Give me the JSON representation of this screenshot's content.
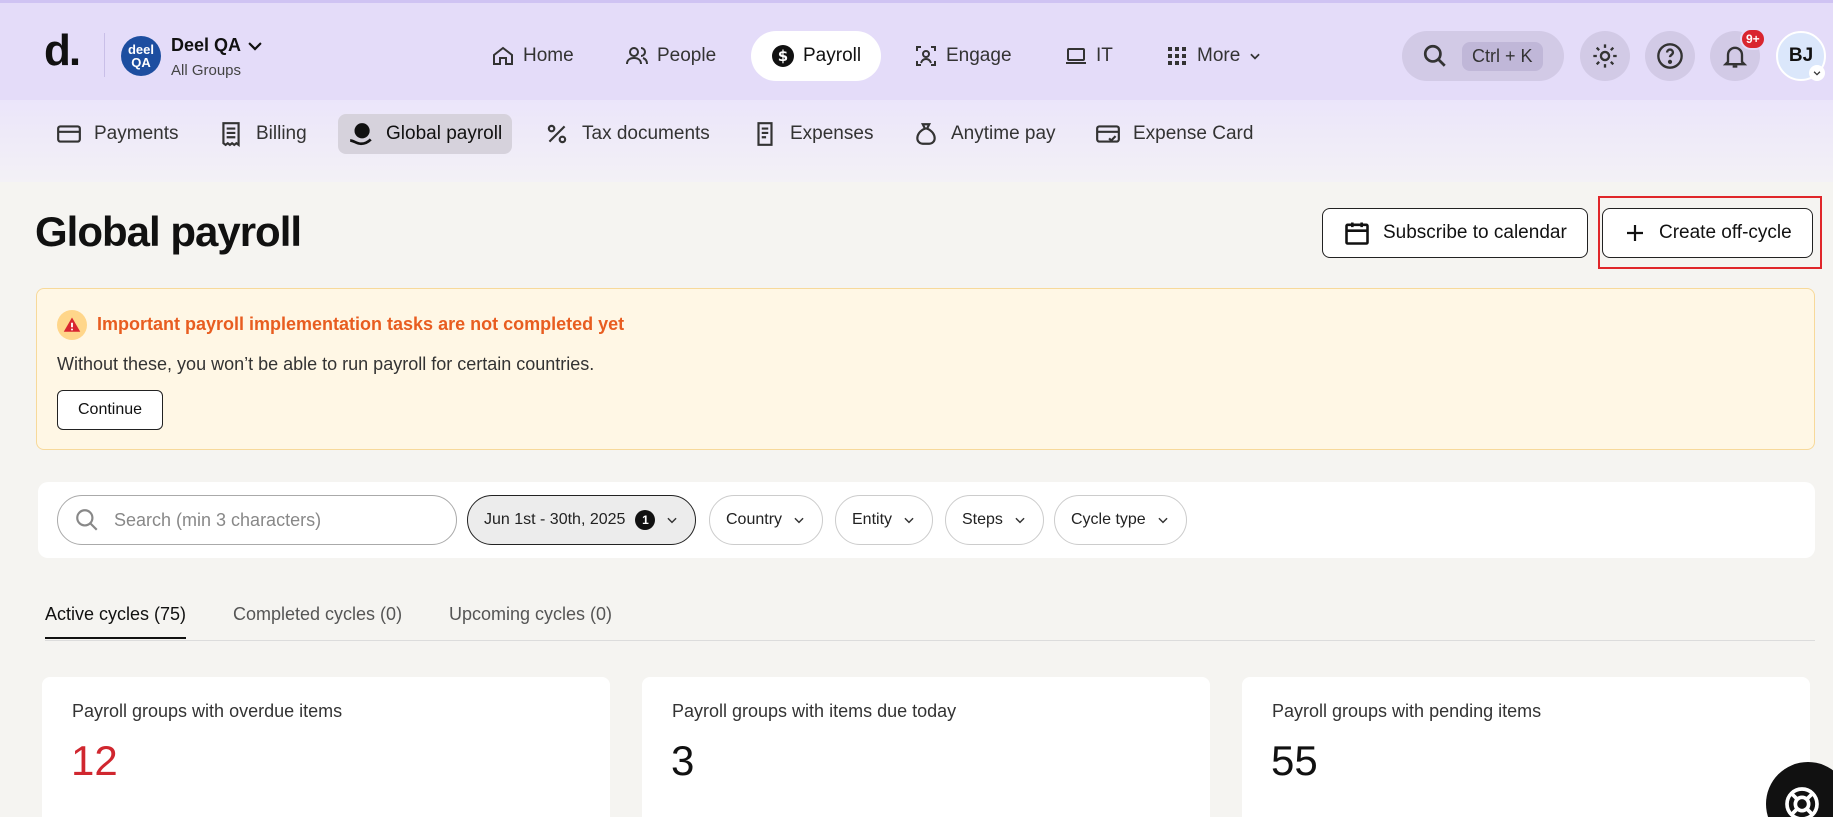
{
  "topbar": {
    "logo": "d.",
    "org": {
      "avatar_text": "deel QA",
      "name": "Deel QA",
      "sub": "All Groups"
    },
    "nav": [
      {
        "label": "Home",
        "icon": "home-icon"
      },
      {
        "label": "People",
        "icon": "people-icon"
      },
      {
        "label": "Payroll",
        "icon": "dollar-circle-icon",
        "active": true
      },
      {
        "label": "Engage",
        "icon": "engage-icon"
      },
      {
        "label": "IT",
        "icon": "laptop-icon"
      },
      {
        "label": "More",
        "icon": "grid-icon"
      }
    ],
    "search_shortcut": "Ctrl + K",
    "notification_badge": "9+",
    "user_initials": "BJ"
  },
  "subnav": [
    {
      "label": "Payments",
      "icon": "card-icon"
    },
    {
      "label": "Billing",
      "icon": "receipt-icon"
    },
    {
      "label": "Global payroll",
      "icon": "globe-hand-icon",
      "active": true
    },
    {
      "label": "Tax documents",
      "icon": "percent-icon"
    },
    {
      "label": "Expenses",
      "icon": "expense-receipt-icon"
    },
    {
      "label": "Anytime pay",
      "icon": "money-bag-icon"
    },
    {
      "label": "Expense Card",
      "icon": "card-check-icon"
    }
  ],
  "header": {
    "title": "Global payroll",
    "subscribe_label": "Subscribe to calendar",
    "create_label": "Create off-cycle"
  },
  "warning": {
    "title": "Important payroll implementation tasks are not completed yet",
    "text": "Without these, you won’t be able to run payroll for certain countries.",
    "button": "Continue"
  },
  "filters": {
    "search_placeholder": "Search (min 3 characters)",
    "date_range": "Jun 1st - 30th, 2025",
    "date_count": "1",
    "chips": [
      "Country",
      "Entity",
      "Steps",
      "Cycle type"
    ]
  },
  "tabs": [
    {
      "label": "Active cycles (75)",
      "active": true
    },
    {
      "label": "Completed cycles (0)"
    },
    {
      "label": "Upcoming cycles (0)"
    }
  ],
  "stats": [
    {
      "label": "Payroll groups with overdue items",
      "value": "12",
      "color": "#d0272f"
    },
    {
      "label": "Payroll groups with items due today",
      "value": "3",
      "color": "#111111"
    },
    {
      "label": "Payroll groups with pending items",
      "value": "55",
      "color": "#111111"
    }
  ],
  "colors": {
    "topbar_bg": "#e4dcf9",
    "accent_red": "#e0262a",
    "warning_title": "#e85d20",
    "warning_bg": "#fff7e5"
  }
}
